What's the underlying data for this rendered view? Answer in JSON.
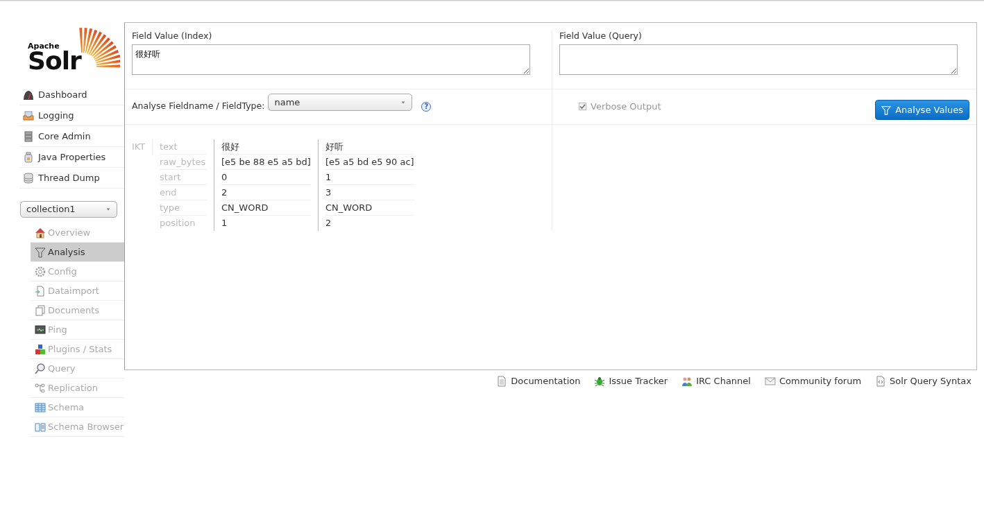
{
  "logo": {
    "small": "Apache",
    "big": "Solr"
  },
  "main_menu": [
    {
      "label": "Dashboard"
    },
    {
      "label": "Logging"
    },
    {
      "label": "Core Admin"
    },
    {
      "label": "Java Properties"
    },
    {
      "label": "Thread Dump"
    }
  ],
  "core_selector": {
    "value": "collection1"
  },
  "core_menu": [
    {
      "label": "Overview",
      "selected": false
    },
    {
      "label": "Analysis",
      "selected": true
    },
    {
      "label": "Config",
      "selected": false
    },
    {
      "label": "Dataimport",
      "selected": false
    },
    {
      "label": "Documents",
      "selected": false
    },
    {
      "label": "Ping",
      "selected": false
    },
    {
      "label": "Plugins / Stats",
      "selected": false
    },
    {
      "label": "Query",
      "selected": false
    },
    {
      "label": "Replication",
      "selected": false
    },
    {
      "label": "Schema",
      "selected": false
    },
    {
      "label": "Schema Browser",
      "selected": false
    }
  ],
  "analysis": {
    "index_field": {
      "label": "Field Value (Index)",
      "value": "很好听"
    },
    "query_field": {
      "label": "Field Value (Query)"
    },
    "fieldtype": {
      "label": "Analyse Fieldname / FieldType:",
      "value": "name",
      "help": "?"
    },
    "verbose": {
      "label": "Verbose Output",
      "checked": true
    },
    "button": "Analyse Values",
    "result": {
      "analyzer": "IKT",
      "attributes": [
        "text",
        "raw_bytes",
        "start",
        "end",
        "type",
        "position"
      ],
      "tokens": [
        {
          "values": [
            "很好",
            "[e5 be 88 e5 a5 bd]",
            "0",
            "2",
            "CN_WORD",
            "1"
          ]
        },
        {
          "values": [
            "好听",
            "[e5 a5 bd e5 90 ac]",
            "1",
            "3",
            "CN_WORD",
            "2"
          ]
        }
      ]
    }
  },
  "footer_links": [
    {
      "label": "Documentation"
    },
    {
      "label": "Issue Tracker"
    },
    {
      "label": "IRC Channel"
    },
    {
      "label": "Community forum"
    },
    {
      "label": "Solr Query Syntax"
    }
  ]
}
